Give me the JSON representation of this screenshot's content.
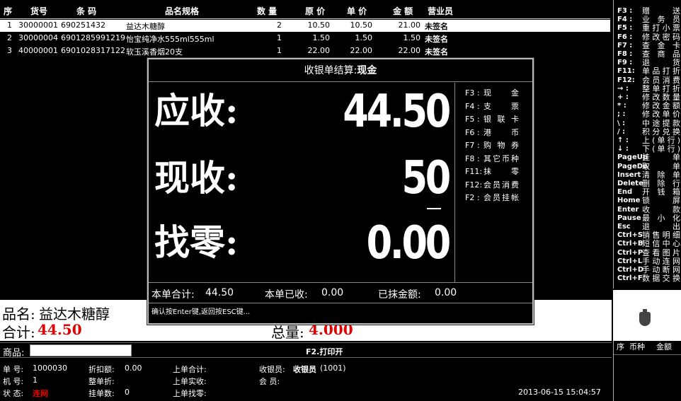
{
  "table": {
    "headers": {
      "seq": "序",
      "item_no": "货号",
      "barcode": "条 码",
      "name": "品名规格",
      "qty": "数 量",
      "orig_price": "原 价",
      "unit_price": "单 价",
      "amount": "金 额",
      "clerk": "营业员"
    },
    "rows": [
      {
        "seq": "1",
        "item_no": "30000001",
        "barcode": "690251432",
        "name": "益达木糖醇",
        "qty": "2",
        "orig_price": "10.50",
        "unit_price": "10.50",
        "amount": "21.00",
        "clerk": "未签名"
      },
      {
        "seq": "2",
        "item_no": "30000004",
        "barcode": "6901285991219",
        "name": "怡宝纯净水555ml555ml",
        "qty": "1",
        "orig_price": "1.50",
        "unit_price": "1.50",
        "amount": "1.50",
        "clerk": "未签名"
      },
      {
        "seq": "3",
        "item_no": "40000001",
        "barcode": "6901028317122",
        "name": "软玉溪香烟20支",
        "qty": "1",
        "orig_price": "22.00",
        "unit_price": "22.00",
        "amount": "22.00",
        "clerk": "未签名"
      }
    ]
  },
  "help": [
    {
      "key": "F3 :",
      "desc": "赠送"
    },
    {
      "key": "F4 :",
      "desc": "业务员"
    },
    {
      "key": "F5 :",
      "desc": "重打小票"
    },
    {
      "key": "F6 :",
      "desc": "修改密码"
    },
    {
      "key": "F7 :",
      "desc": "查金卡"
    },
    {
      "key": "F8 :",
      "desc": "查商品"
    },
    {
      "key": "F9 :",
      "desc": "退货"
    },
    {
      "key": "F11:",
      "desc": "单品打折"
    },
    {
      "key": "F12:",
      "desc": "会员消费"
    },
    {
      "key": "→ :",
      "desc": "整单打折"
    },
    {
      "key": "+ :",
      "desc": "修改数量"
    },
    {
      "key": "* :",
      "desc": "修改金额"
    },
    {
      "key": "; :",
      "desc": "修改单价"
    },
    {
      "key": "\\ :",
      "desc": "中途提款"
    },
    {
      "key": "/ :",
      "desc": "积分兑换"
    },
    {
      "key": "↑ :",
      "desc": "上(单行)"
    },
    {
      "key": "↓ :",
      "desc": "下(单行)"
    },
    {
      "key": "PageUp",
      "desc": "挂单"
    },
    {
      "key": "PageDo",
      "desc": "取单"
    },
    {
      "key": "Insert",
      "desc": "清除单"
    },
    {
      "key": "Delete",
      "desc": "删除行"
    },
    {
      "key": "End",
      "desc": "开钱箱"
    },
    {
      "key": "Home",
      "desc": "锁屏"
    },
    {
      "key": "Enter",
      "desc": "收款"
    },
    {
      "key": "Pause",
      "desc": "最小化"
    },
    {
      "key": "Esc",
      "desc": "退出"
    },
    {
      "key": "Ctrl+S",
      "desc": "销售明细"
    },
    {
      "key": "Ctrl+B",
      "desc": "短信中心"
    },
    {
      "key": "Ctrl+P",
      "desc": "查看图片"
    },
    {
      "key": "Ctrl+L",
      "desc": "手动连网"
    },
    {
      "key": "Ctrl+D",
      "desc": "手动断网"
    },
    {
      "key": "Ctrl+F",
      "desc": "数据交换"
    }
  ],
  "info": {
    "name_label": "品名:",
    "name_value": "益达木糖醇",
    "total_label": "合计:",
    "total_value": "44.50",
    "qty_label": "总量:",
    "qty_value": "4.000"
  },
  "bar": {
    "product_label": "商品:",
    "product_value": "",
    "print_label": "F2.打印开"
  },
  "bottom": {
    "order_label": "单  号:",
    "order_value": "1000030",
    "discount_label": "折扣额:",
    "discount_value": "0.00",
    "last_total_label": "上单合计:",
    "cashier_label": "收银员:",
    "cashier_value": "收银员",
    "cashier_id": "(1001)",
    "machine_label": "机  号:",
    "machine_value": "1",
    "whole_disc_label": "整单折:",
    "last_paid_label": "上单实收:",
    "member_label": "会  员:",
    "status_label": "状  态:",
    "status_value": "连网",
    "hold_label": "挂单数:",
    "hold_value": "0",
    "last_change_label": "上单找零:",
    "datetime": "2013-06-15 15:04:57"
  },
  "side2": {
    "seq": "序",
    "currency": "币种",
    "amount": "金额"
  },
  "dialog": {
    "title_prefix": "收银单结算:",
    "title_method": "现金",
    "due_label": "应收:",
    "due_value": "44.50",
    "paid_label": "现收:",
    "paid_value": "50",
    "change_label": "找零:",
    "change_value": "0.00",
    "keys": [
      {
        "key": "F3 :",
        "desc": "现金"
      },
      {
        "key": "F4 :",
        "desc": "支票"
      },
      {
        "key": "F5 :",
        "desc": "银联卡"
      },
      {
        "key": "F6 :",
        "desc": "港币"
      },
      {
        "key": "F7 :",
        "desc": "购物券"
      },
      {
        "key": "F8 :",
        "desc": "其它币种"
      },
      {
        "key": "F11:",
        "desc": "抹零"
      },
      {
        "key": "F12:",
        "desc": "会员消费"
      },
      {
        "key": "F2 :",
        "desc": "会员挂帐"
      }
    ],
    "sum_total_label": "本单合计:",
    "sum_total_value": "44.50",
    "sum_received_label": "本单已收:",
    "sum_received_value": "0.00",
    "sum_erased_label": "已抹金额:",
    "sum_erased_value": "0.00",
    "hint": "确认按Enter键,返回按ESC键..."
  }
}
